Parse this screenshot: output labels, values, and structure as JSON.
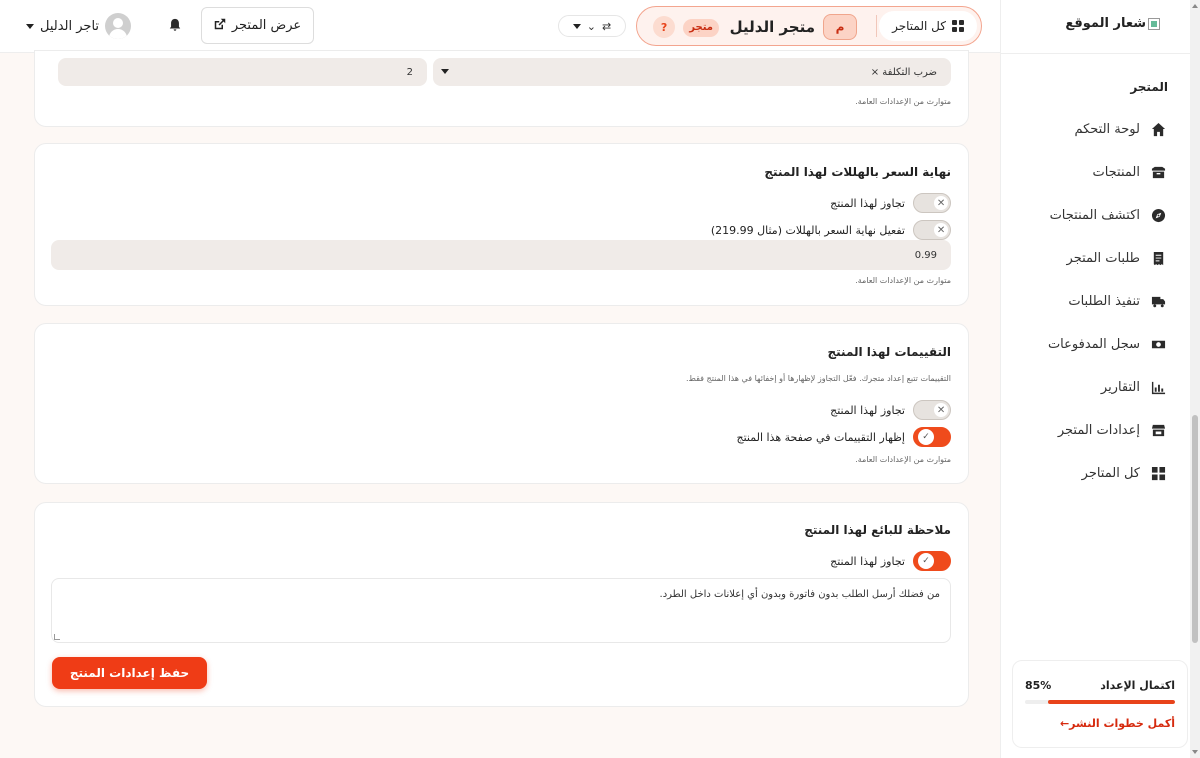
{
  "sidebar": {
    "logo_text": "شعار الموقع",
    "section_title": "المتجر",
    "items": [
      {
        "label": "لوحة التحكم",
        "icon": "home-icon"
      },
      {
        "label": "المنتجات",
        "icon": "box-icon"
      },
      {
        "label": "اكتشف المنتجات",
        "icon": "compass-icon"
      },
      {
        "label": "طلبات المتجر",
        "icon": "receipt-icon"
      },
      {
        "label": "تنفيذ الطلبات",
        "icon": "truck-icon"
      },
      {
        "label": "سجل المدفوعات",
        "icon": "money-icon"
      },
      {
        "label": "التقارير",
        "icon": "chart-icon"
      },
      {
        "label": "إعدادات المتجر",
        "icon": "store-icon"
      },
      {
        "label": "كل المتاجر",
        "icon": "grid-icon"
      }
    ],
    "progress": {
      "title": "اكتمال الإعداد",
      "value_text": "85%",
      "value": 0.85,
      "link": "أكمل خطوات النشر←"
    }
  },
  "topbar": {
    "all_stores": "كل المتاجر",
    "store_initial": "م",
    "store_name": "متجر الدليل",
    "store_badge": "متجر",
    "help": "?",
    "view_store": "عرض المتجر",
    "user_name": "تاجر الدليل"
  },
  "cards": {
    "top": {
      "select_value": "ضرب التكلفة ×",
      "number_value": "2",
      "note": "متوارث من الإعدادات العامة."
    },
    "price_ending": {
      "title": "نهاية السعر بالهللات لهذا المنتج",
      "override_label": "تجاوز لهذا المنتج",
      "enable_label": "تفعيل نهاية السعر بالهللات (مثال 219.99)",
      "value": "0.99",
      "note": "متوارث من الإعدادات العامة."
    },
    "reviews": {
      "title": "التقييمات لهذا المنتج",
      "description": "التقييمات تتبع إعداد متجرك. فعّل التجاوز لإظهارها أو إخفائها في هذا المنتج فقط.",
      "override_label": "تجاوز لهذا المنتج",
      "show_label": "إظهار التقييمات في صفحة هذا المنتج",
      "note": "متوارث من الإعدادات العامة."
    },
    "seller_note": {
      "title": "ملاحظة للبائع لهذا المنتج",
      "override_label": "تجاوز لهذا المنتج",
      "text": "من فضلك أرسل الطلب بدون فاتورة وبدون أي إعلانات داخل الطرد.",
      "save_button": "حفظ إعدادات المنتج"
    }
  },
  "colors": {
    "accent": "#ef3c16",
    "accent_light": "#fcd3c5",
    "background": "#fdf8f5"
  }
}
